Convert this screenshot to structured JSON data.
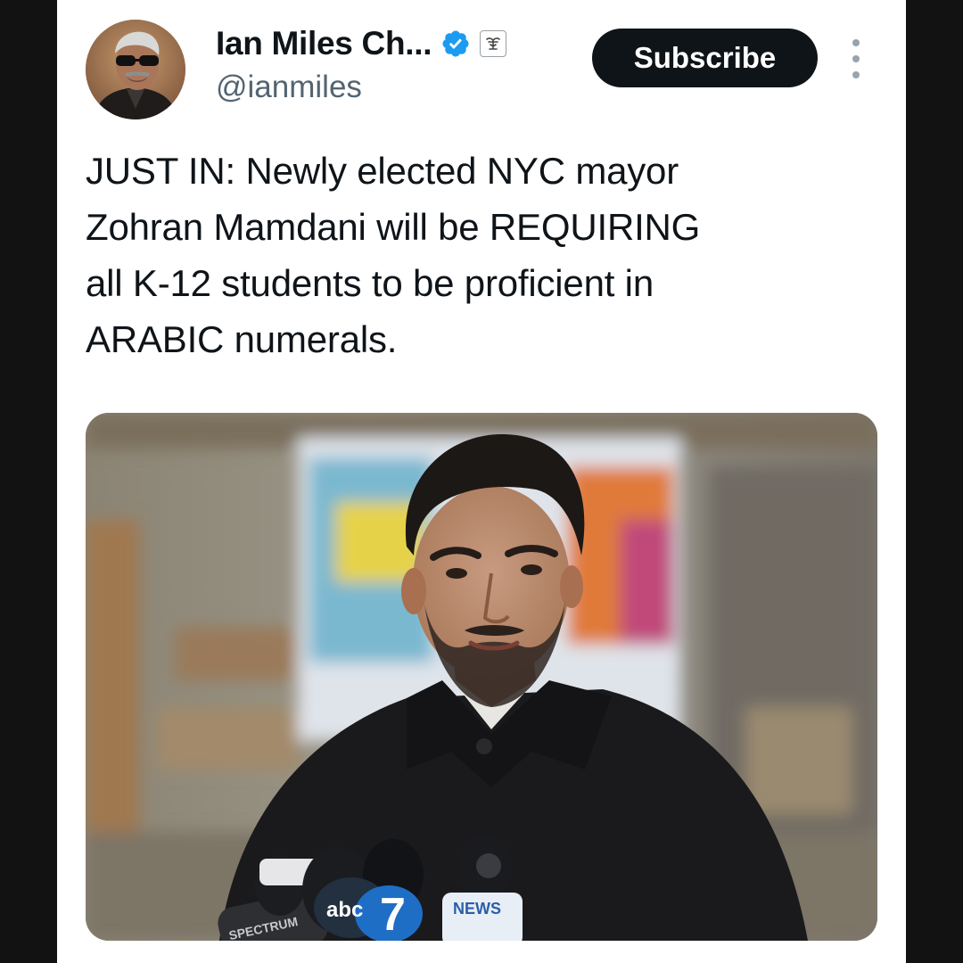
{
  "tweet": {
    "author": {
      "display_name": "Ian Miles Ch...",
      "handle": "@ianmiles",
      "verified": true,
      "verified_icon": "verified-badge-icon",
      "affiliation_icon": "affiliate-badge-icon",
      "avatar": "author-avatar"
    },
    "subscribe_label": "Subscribe",
    "more_icon": "more-vertical-icon",
    "text": "JUST IN: Newly elected NYC mayor\nZohran Mamdani will be REQUIRING\nall K-12 students to be proficient in\nARABIC numerals.",
    "media": {
      "type": "photo",
      "mic_labels": [
        "abc",
        "7",
        "NEWS",
        "SPECTRUM"
      ]
    }
  },
  "colors": {
    "background": "#121212",
    "card": "#ffffff",
    "text_primary": "#0f1419",
    "text_secondary": "#536471",
    "subscribe_bg": "#0f1419",
    "verified_blue": "#1d9bf0"
  }
}
